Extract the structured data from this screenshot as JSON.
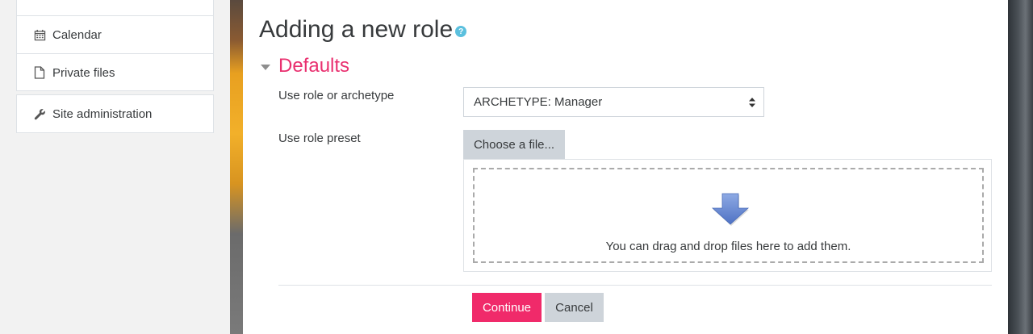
{
  "sidebar": {
    "items": [
      {
        "label": "Calendar",
        "icon": "calendar-icon"
      },
      {
        "label": "Private files",
        "icon": "file-icon"
      },
      {
        "label": "Site administration",
        "icon": "wrench-icon"
      }
    ]
  },
  "page": {
    "title": "Adding a new role",
    "help_icon": "?"
  },
  "section": {
    "title": "Defaults"
  },
  "form": {
    "archetype_label": "Use role or archetype",
    "archetype_value": "ARCHETYPE: Manager",
    "preset_label": "Use role preset",
    "choose_file_label": "Choose a file...",
    "drop_text": "You can drag and drop files here to add them."
  },
  "actions": {
    "continue_label": "Continue",
    "cancel_label": "Cancel"
  },
  "colors": {
    "accent": "#e9306f",
    "primary_button": "#f02a6a",
    "secondary_button": "#ced4da",
    "help": "#5bc0de"
  }
}
